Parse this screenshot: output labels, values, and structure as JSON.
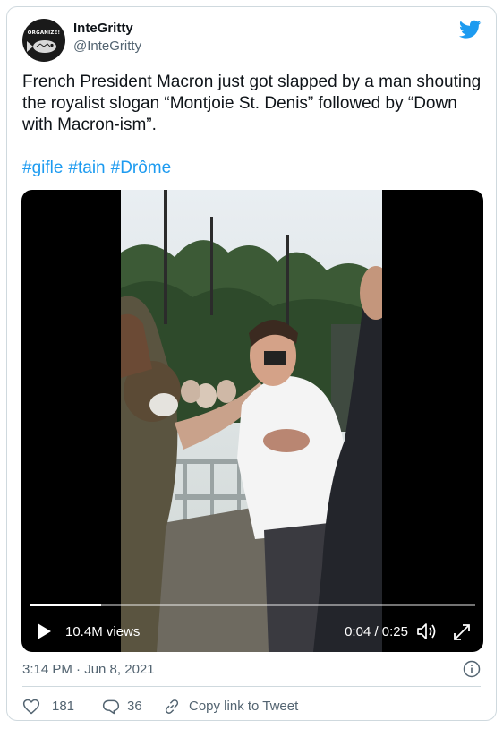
{
  "user": {
    "name": "InteGritty",
    "handle": "@InteGritty",
    "avatar_text": "ORGANIZE!"
  },
  "tweet": {
    "text": "French President Macron just got slapped by a man shouting the royalist slogan “Montjoie St. Denis” followed by “Down with Macron-ism”.",
    "hashtags": [
      "#gifle",
      "#tain",
      "#Drôme"
    ],
    "timestamp": "3:14 PM · Jun 8, 2021"
  },
  "video": {
    "views": "10.4M views",
    "time": "0:04 / 0:25",
    "progress": 0.16
  },
  "actions": {
    "likes": "181",
    "replies": "36",
    "copy_link": "Copy link to Tweet"
  },
  "colors": {
    "accent": "#1d9bf0",
    "secondary_text": "#536471",
    "border": "#cfd9de"
  },
  "icons": [
    "twitter-bird-icon",
    "play-icon",
    "volume-icon",
    "fullscreen-icon",
    "info-icon",
    "heart-icon",
    "reply-icon",
    "link-icon"
  ]
}
